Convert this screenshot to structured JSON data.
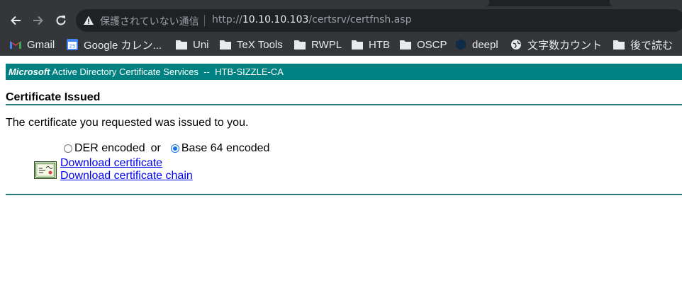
{
  "browser": {
    "security_text": "保護されていない通信",
    "url": {
      "scheme": "http://",
      "host": "10.10.10.103",
      "path": "/certsrv/certfnsh.asp"
    },
    "bookmarks": [
      {
        "label": "Gmail",
        "icon": "gmail-icon"
      },
      {
        "label": "Google カレン...",
        "icon": "calendar-icon",
        "badge": "25"
      },
      {
        "label": "Uni",
        "icon": "folder-icon"
      },
      {
        "label": "TeX Tools",
        "icon": "folder-icon"
      },
      {
        "label": "RWPL",
        "icon": "folder-icon"
      },
      {
        "label": "HTB",
        "icon": "folder-icon"
      },
      {
        "label": "OSCP",
        "icon": "folder-icon"
      },
      {
        "label": "deepl",
        "icon": "deepl-icon"
      },
      {
        "label": "文字数カウント",
        "icon": "globe-icon"
      },
      {
        "label": "後で読む",
        "icon": "folder-icon"
      }
    ]
  },
  "page": {
    "banner_brand": "Microsoft",
    "banner_text": "Active Directory Certificate Services  --  HTB-SIZZLE-CA",
    "title": "Certificate Issued",
    "message": "The certificate you requested was issued to you.",
    "encoding": {
      "der_label": "DER encoded",
      "or_text": "or",
      "base64_label": "Base 64 encoded",
      "selected": "base64"
    },
    "links": {
      "download_cert": "Download certificate",
      "download_chain": "Download certificate chain"
    }
  },
  "colors": {
    "banner": "#008080",
    "link": "#0000ee",
    "rule": "#2a7a7a"
  }
}
